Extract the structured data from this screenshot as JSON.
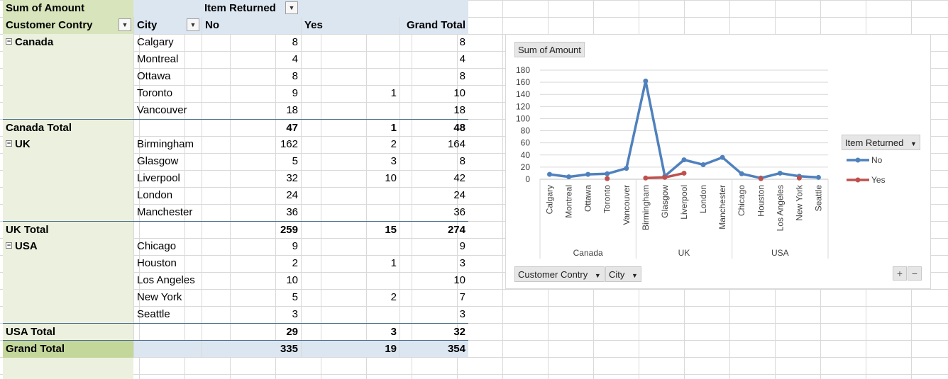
{
  "pivot": {
    "data_field": "Sum of Amount",
    "column_field": "Item Returned",
    "row_field_1": "Customer Contry",
    "row_field_2": "City",
    "col_headers": [
      "No",
      "Yes",
      "Grand Total"
    ],
    "rows": [
      {
        "kind": "group",
        "label": "Canada",
        "city": "Calgary",
        "no": "8",
        "yes": "",
        "total": "8"
      },
      {
        "kind": "item",
        "label": "",
        "city": "Montreal",
        "no": "4",
        "yes": "",
        "total": "4"
      },
      {
        "kind": "item",
        "label": "",
        "city": "Ottawa",
        "no": "8",
        "yes": "",
        "total": "8"
      },
      {
        "kind": "item",
        "label": "",
        "city": "Toronto",
        "no": "9",
        "yes": "1",
        "total": "10"
      },
      {
        "kind": "item",
        "label": "",
        "city": "Vancouver",
        "no": "18",
        "yes": "",
        "total": "18"
      },
      {
        "kind": "subtotal",
        "label": "Canada Total",
        "city": "",
        "no": "47",
        "yes": "1",
        "total": "48"
      },
      {
        "kind": "group",
        "label": "UK",
        "city": "Birmingham",
        "no": "162",
        "yes": "2",
        "total": "164"
      },
      {
        "kind": "item",
        "label": "",
        "city": "Glasgow",
        "no": "5",
        "yes": "3",
        "total": "8"
      },
      {
        "kind": "item",
        "label": "",
        "city": "Liverpool",
        "no": "32",
        "yes": "10",
        "total": "42"
      },
      {
        "kind": "item",
        "label": "",
        "city": "London",
        "no": "24",
        "yes": "",
        "total": "24"
      },
      {
        "kind": "item",
        "label": "",
        "city": "Manchester",
        "no": "36",
        "yes": "",
        "total": "36"
      },
      {
        "kind": "subtotal",
        "label": "UK Total",
        "city": "",
        "no": "259",
        "yes": "15",
        "total": "274"
      },
      {
        "kind": "group",
        "label": "USA",
        "city": "Chicago",
        "no": "9",
        "yes": "",
        "total": "9"
      },
      {
        "kind": "item",
        "label": "",
        "city": "Houston",
        "no": "2",
        "yes": "1",
        "total": "3"
      },
      {
        "kind": "item",
        "label": "",
        "city": "Los Angeles",
        "no": "10",
        "yes": "",
        "total": "10"
      },
      {
        "kind": "item",
        "label": "",
        "city": "New York",
        "no": "5",
        "yes": "2",
        "total": "7"
      },
      {
        "kind": "item",
        "label": "",
        "city": "Seattle",
        "no": "3",
        "yes": "",
        "total": "3"
      },
      {
        "kind": "subtotal",
        "label": "USA Total",
        "city": "",
        "no": "29",
        "yes": "3",
        "total": "32"
      },
      {
        "kind": "grand",
        "label": "Grand Total",
        "city": "",
        "no": "335",
        "yes": "19",
        "total": "354"
      }
    ]
  },
  "chart_panel": {
    "value_button": "Sum of Amount",
    "legend_button": "Item Returned",
    "axis_button_1": "Customer Contry",
    "axis_button_2": "City",
    "plus_label": "+",
    "minus_label": "−"
  },
  "chart_data": {
    "type": "line",
    "title": "",
    "xlabel": "",
    "ylabel": "",
    "ylim": [
      0,
      180
    ],
    "yticks": [
      0,
      20,
      40,
      60,
      80,
      100,
      120,
      140,
      160,
      180
    ],
    "grid": true,
    "legend_title": "Item Returned",
    "legend_position": "right",
    "categories": [
      "Calgary",
      "Montreal",
      "Ottawa",
      "Toronto",
      "Vancouver",
      "Birmingham",
      "Glasgow",
      "Liverpool",
      "London",
      "Manchester",
      "Chicago",
      "Houston",
      "Los Angeles",
      "New York",
      "Seattle"
    ],
    "groups": [
      {
        "label": "Canada",
        "count": 5
      },
      {
        "label": "UK",
        "count": 5
      },
      {
        "label": "USA",
        "count": 5
      }
    ],
    "series": [
      {
        "name": "No",
        "color": "#4f81bd",
        "values": [
          8,
          4,
          8,
          9,
          18,
          162,
          5,
          32,
          24,
          36,
          9,
          2,
          10,
          5,
          3
        ]
      },
      {
        "name": "Yes",
        "color": "#c0504d",
        "values": [
          null,
          null,
          null,
          1,
          null,
          2,
          3,
          10,
          null,
          null,
          null,
          1,
          null,
          2,
          null
        ]
      }
    ]
  }
}
